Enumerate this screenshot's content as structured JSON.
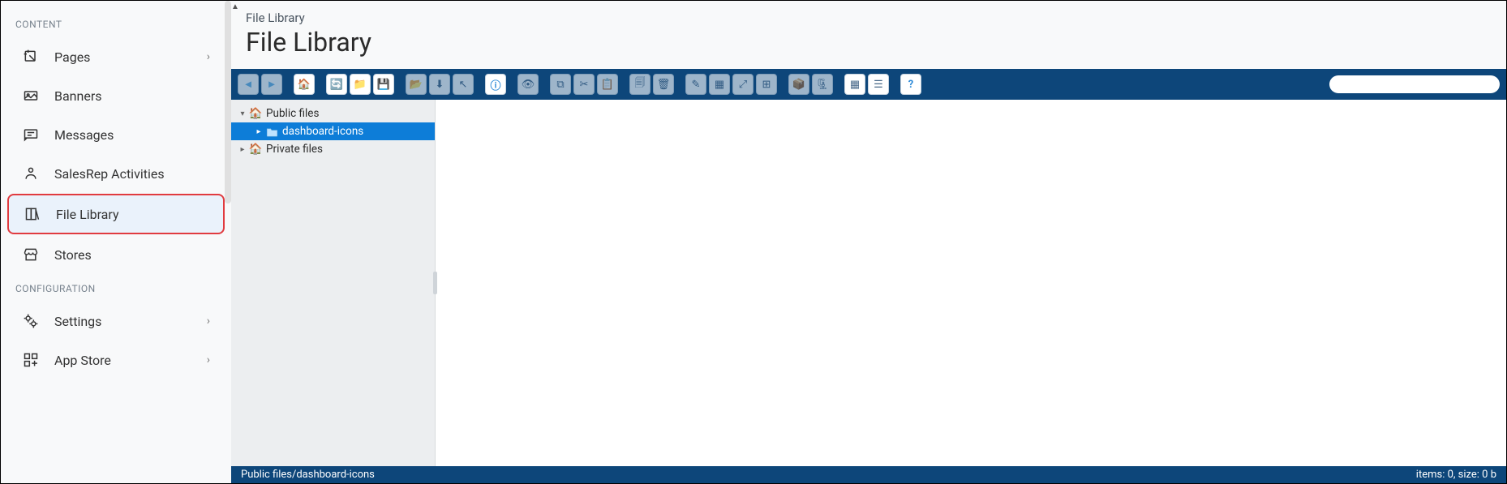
{
  "sidebar": {
    "sections": [
      {
        "label": "CONTENT",
        "items": [
          {
            "label": "Pages",
            "icon": "pages-icon",
            "has_chevron": true
          },
          {
            "label": "Banners",
            "icon": "banners-icon"
          },
          {
            "label": "Messages",
            "icon": "messages-icon"
          },
          {
            "label": "SalesRep Activities",
            "icon": "salesrep-icon"
          },
          {
            "label": "File Library",
            "icon": "file-library-icon",
            "active": true
          },
          {
            "label": "Stores",
            "icon": "stores-icon"
          }
        ]
      },
      {
        "label": "CONFIGURATION",
        "items": [
          {
            "label": "Settings",
            "icon": "settings-icon",
            "has_chevron": true
          },
          {
            "label": "App Store",
            "icon": "app-store-icon",
            "has_chevron": true
          }
        ]
      }
    ]
  },
  "breadcrumb": "File Library",
  "page_title": "File Library",
  "toolbar": {
    "search_placeholder": ""
  },
  "tree": {
    "public_label": "Public files",
    "dashboard_icons_label": "dashboard-icons",
    "private_label": "Private files"
  },
  "status": {
    "path": "Public files/dashboard-icons",
    "info": "items: 0, size: 0 b"
  }
}
